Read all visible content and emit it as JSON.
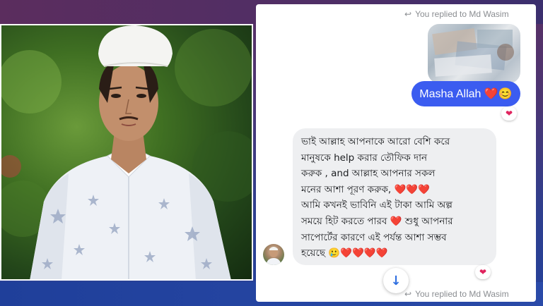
{
  "chat": {
    "reply_note_top": "You replied to Md Wasim",
    "reply_note_bottom": "You replied to Md Wasim",
    "my_message": "Masha Allah ❤️😊",
    "my_reaction": "❤",
    "their_message": "ভাই আল্লাহ আপনাকে আরো বেশি করে\nমানুষকে help করার তৌফিক দান\nকরুক , and আল্লাহ আপনার সকল\nমনের আশা পূরণ করুক, ❤️❤️❤️\nআমি কখনই ভাবিনি এই টাকা আমি অল্প\nসময়ে হিট করতে পারব ❤️ শুধু আপনার\nসাপোর্টের কারণে এই পর্যন্ত আশা সম্ভব\nহয়েছে 🥲❤️❤️❤️❤️",
    "their_reaction": "❤",
    "scroll_icon": "↓"
  },
  "icons": {
    "reply": "reply-arrow-icon",
    "heart": "heart-icon",
    "scroll": "arrow-down-icon"
  },
  "colors": {
    "my_bubble": "#3b5cf0",
    "their_bubble": "#eeeff1",
    "heart": "#e0245e"
  }
}
